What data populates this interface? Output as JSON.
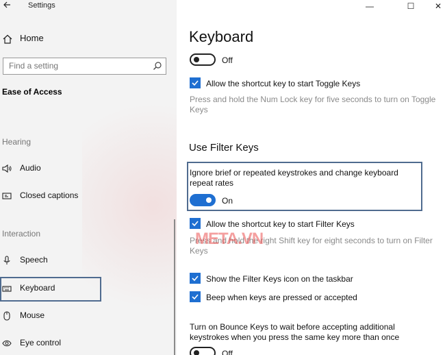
{
  "window": {
    "title": "Settings",
    "controls": {
      "minimize": "—",
      "maximize": "☐",
      "close": "✕"
    }
  },
  "sidebar": {
    "home_label": "Home",
    "search_placeholder": "Find a setting",
    "section_title": "Ease of Access",
    "groups": {
      "hearing": "Hearing",
      "interaction": "Interaction"
    },
    "items": [
      {
        "label": "Audio",
        "icon": "speaker-icon"
      },
      {
        "label": "Closed captions",
        "icon": "captions-icon"
      },
      {
        "label": "Speech",
        "icon": "microphone-icon"
      },
      {
        "label": "Keyboard",
        "icon": "keyboard-icon",
        "selected": true
      },
      {
        "label": "Mouse",
        "icon": "mouse-icon"
      },
      {
        "label": "Eye control",
        "icon": "eye-icon"
      }
    ]
  },
  "main": {
    "page_title": "Keyboard",
    "toggle_keys": {
      "toggle_state": "Off",
      "shortcut_label": "Allow the shortcut key to start Toggle Keys",
      "shortcut_desc": "Press and hold the Num Lock key for five seconds to turn on Toggle Keys"
    },
    "filter_keys": {
      "heading": "Use Filter Keys",
      "ignore_label": "Ignore brief or repeated keystrokes and change keyboard repeat rates",
      "toggle_state": "On",
      "shortcut_label": "Allow the shortcut key to start Filter Keys",
      "shortcut_desc": "Press and hold the right Shift key for eight seconds to turn on Filter Keys",
      "show_icon_label": "Show the Filter Keys icon on the taskbar",
      "beep_label": "Beep when keys are pressed or accepted"
    },
    "bounce_keys": {
      "label": "Turn on Bounce Keys to wait before accepting additional keystrokes when you press the same key more than once",
      "toggle_state": "Off"
    }
  },
  "watermark": "META.VN",
  "colors": {
    "accent": "#1f6fd1",
    "highlight_border": "#4f6b8f",
    "sidebar_bg": "#f3f3f3",
    "muted_text": "#8a8a8a"
  }
}
